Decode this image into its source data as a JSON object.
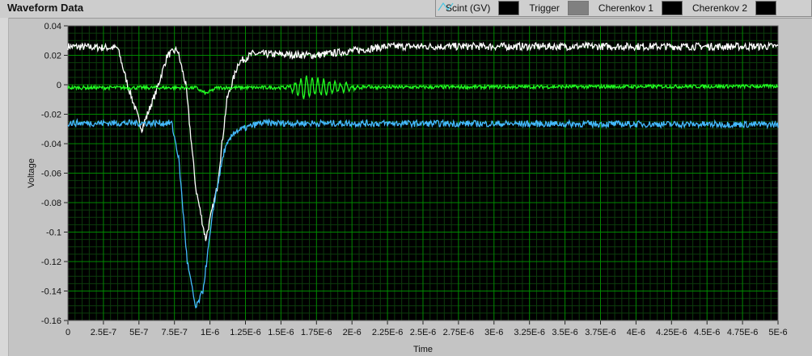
{
  "title": "Waveform Data",
  "legend": [
    {
      "label": "Scint (GV)",
      "color": "#ffffff",
      "dim": false
    },
    {
      "label": "Trigger",
      "color": "#e8a0a0",
      "dim": true
    },
    {
      "label": "Cherenkov 1",
      "color": "#22ff22",
      "dim": false
    },
    {
      "label": "Cherenkov 2",
      "color": "#44bbff",
      "dim": false
    }
  ],
  "chart_data": {
    "type": "line",
    "title": "Waveform Data",
    "xlabel": "Time",
    "ylabel": "Voltage",
    "xlim": [
      0,
      5e-06
    ],
    "ylim": [
      -0.16,
      0.04
    ],
    "grid": true,
    "legend_position": "top-right",
    "x_ticks": [
      "0",
      "2.5E-7",
      "5E-7",
      "7.5E-7",
      "1E-6",
      "1.25E-6",
      "1.5E-6",
      "1.75E-6",
      "2E-6",
      "2.25E-6",
      "2.5E-6",
      "2.75E-6",
      "3E-6",
      "3.25E-6",
      "3.5E-6",
      "3.75E-6",
      "4E-6",
      "4.25E-6",
      "4.5E-6",
      "4.75E-6",
      "5E-6"
    ],
    "y_ticks": [
      "0.04",
      "0.02",
      "0",
      "-0.02",
      "-0.04",
      "-0.06",
      "-0.08",
      "-0.1",
      "-0.12",
      "-0.14",
      "-0.16"
    ],
    "series": [
      {
        "name": "Scint (GV)",
        "color": "#ffffff",
        "noise": 0.0025,
        "points": [
          [
            0,
            0.026
          ],
          [
            3.5e-07,
            0.025
          ],
          [
            4.2e-07,
            0.0
          ],
          [
            5.2e-07,
            -0.03
          ],
          [
            6.2e-07,
            -0.005
          ],
          [
            7e-07,
            0.02
          ],
          [
            7.7e-07,
            0.024
          ],
          [
            8.3e-07,
            0.0
          ],
          [
            9e-07,
            -0.07
          ],
          [
            9.7e-07,
            -0.105
          ],
          [
            1.05e-06,
            -0.07
          ],
          [
            1.12e-06,
            -0.01
          ],
          [
            1.2e-06,
            0.015
          ],
          [
            1.3e-06,
            0.021
          ],
          [
            1.75e-06,
            0.02
          ],
          [
            2.25e-06,
            0.026
          ],
          [
            5e-06,
            0.026
          ]
        ]
      },
      {
        "name": "Cherenkov 1",
        "color": "#22ff22",
        "noise": 0.0012,
        "points": [
          [
            0,
            -0.002
          ],
          [
            9e-07,
            -0.002
          ],
          [
            9.7e-07,
            -0.006
          ],
          [
            1.05e-06,
            -0.002
          ],
          [
            5e-06,
            -0.001
          ]
        ],
        "burst": {
          "start": 1.55e-06,
          "end": 2.2e-06,
          "amplitude": 0.012,
          "period": 4e-08
        }
      },
      {
        "name": "Cherenkov 2",
        "color": "#44bbff",
        "noise": 0.0022,
        "points": [
          [
            0,
            -0.026
          ],
          [
            7.3e-07,
            -0.026
          ],
          [
            7.8e-07,
            -0.05
          ],
          [
            8.4e-07,
            -0.12
          ],
          [
            9e-07,
            -0.152
          ],
          [
            9.5e-07,
            -0.14
          ],
          [
            1.03e-06,
            -0.08
          ],
          [
            1.1e-06,
            -0.045
          ],
          [
            1.17e-06,
            -0.032
          ],
          [
            1.35e-06,
            -0.026
          ],
          [
            5e-06,
            -0.027
          ]
        ]
      }
    ]
  }
}
